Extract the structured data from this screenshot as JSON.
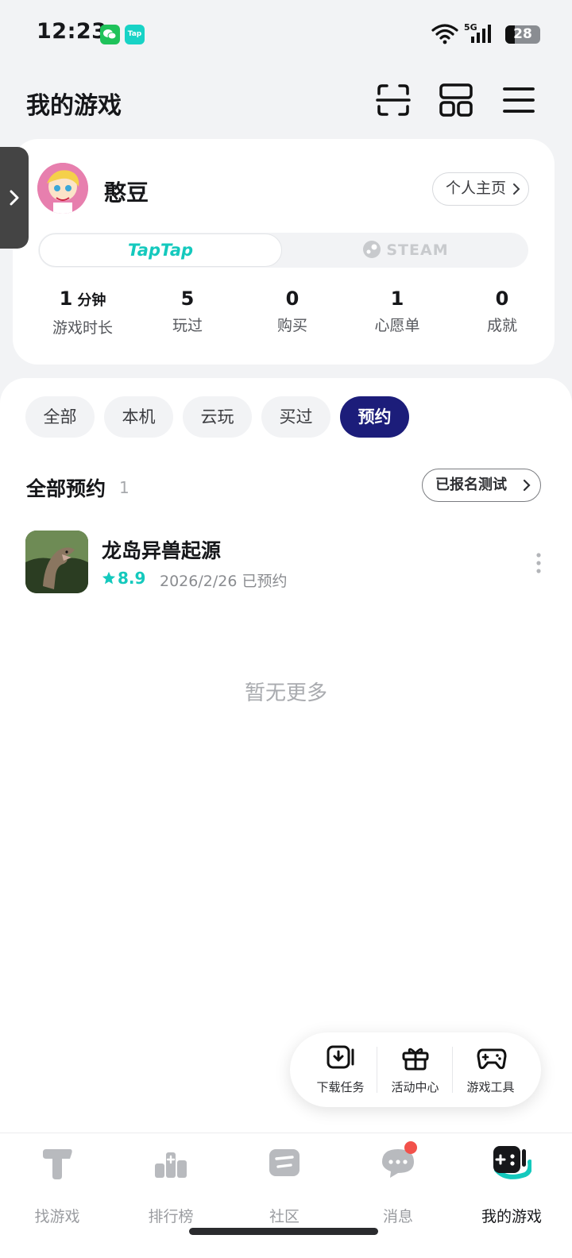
{
  "status_bar": {
    "time": "12:23",
    "tap_badge": "Tap",
    "battery": "28",
    "network": "5G"
  },
  "header": {
    "title": "我的游戏"
  },
  "profile": {
    "username": "憨豆",
    "home_button": "个人主页",
    "platforms": [
      "TapTap",
      "STEAM"
    ],
    "stats": [
      {
        "value": "1",
        "unit": "分钟",
        "label": "游戏时长"
      },
      {
        "value": "5",
        "unit": "",
        "label": "玩过"
      },
      {
        "value": "0",
        "unit": "",
        "label": "购买"
      },
      {
        "value": "1",
        "unit": "",
        "label": "心愿单"
      },
      {
        "value": "0",
        "unit": "",
        "label": "成就"
      }
    ]
  },
  "filters": [
    "全部",
    "本机",
    "云玩",
    "买过",
    "预约"
  ],
  "active_filter": "预约",
  "section": {
    "title": "全部预约",
    "count": "1",
    "test_button": "已报名测试"
  },
  "games": [
    {
      "name": "龙岛异兽起源",
      "rating": "8.9",
      "meta": "2026/2/26 已预约"
    }
  ],
  "empty_text": "暂无更多",
  "float_toolbar": [
    {
      "icon": "download-icon",
      "label": "下载任务"
    },
    {
      "icon": "gift-icon",
      "label": "活动中心"
    },
    {
      "icon": "gamepad-icon",
      "label": "游戏工具"
    }
  ],
  "bottom_nav": [
    {
      "icon": "find-games-icon",
      "label": "找游戏"
    },
    {
      "icon": "ranking-icon",
      "label": "排行榜"
    },
    {
      "icon": "community-icon",
      "label": "社区"
    },
    {
      "icon": "message-icon",
      "label": "消息"
    },
    {
      "icon": "my-games-icon",
      "label": "我的游戏"
    }
  ],
  "colors": {
    "accent": "#14c9bd",
    "active_chip": "#1c1d7a",
    "badge": "#f2514b"
  }
}
